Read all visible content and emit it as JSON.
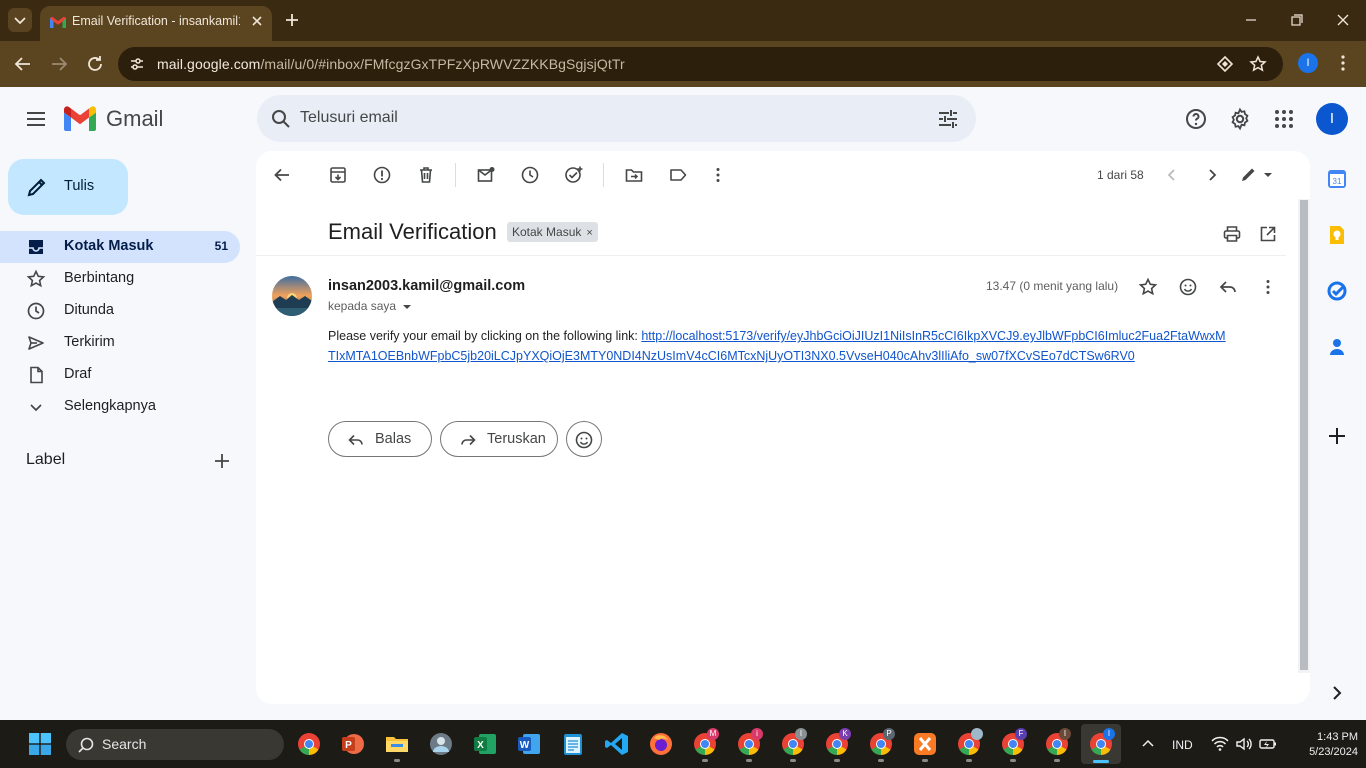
{
  "browser": {
    "tab_title": "Email Verification - insankamil1",
    "url_host": "mail.google.com",
    "url_path": "/mail/u/0/#inbox/FMfcgzGxTPFzXpRWVZZKKBgSgjsjQtTr",
    "profile_initial": "I"
  },
  "header": {
    "app_name": "Gmail",
    "search_placeholder": "Telusuri email",
    "avatar_initial": "I"
  },
  "sidebar": {
    "compose_label": "Tulis",
    "items": [
      {
        "label": "Kotak Masuk",
        "count": "51",
        "icon": "inbox-icon"
      },
      {
        "label": "Berbintang",
        "count": "",
        "icon": "star-icon"
      },
      {
        "label": "Ditunda",
        "count": "",
        "icon": "clock-icon"
      },
      {
        "label": "Terkirim",
        "count": "",
        "icon": "send-icon"
      },
      {
        "label": "Draf",
        "count": "",
        "icon": "draft-icon"
      },
      {
        "label": "Selengkapnya",
        "count": "",
        "icon": "chevron-down-icon"
      }
    ],
    "labels_heading": "Label"
  },
  "message_view": {
    "pager": "1 dari 58",
    "subject": "Email Verification",
    "label_chip": "Kotak Masuk",
    "sender": "insan2003.kamil@gmail.com",
    "recipient": "kepada saya",
    "time": "13.47 (0 menit yang lalu)",
    "body_prefix": "Please verify your email by clicking on the following link: ",
    "link": "http://localhost:5173/verify/eyJhbGciOiJIUzI1NiIsInR5cCI6IkpXVCJ9.eyJlbWFpbCI6Imluc2Fua2FtaWwxMTIxMTA1OEBnbWFpbC5jb20iLCJpYXQiOjE3MTY0NDI4NzUsImV4cCI6MTcxNjUyOTI3NX0.5VvseH040cAhv3lIliAfo_sw07fXCvSEo7dCTSw6RV0",
    "reply_button": "Balas",
    "forward_button": "Teruskan"
  },
  "taskbar": {
    "search_label": "Search",
    "language": "IND",
    "time": "1:43 PM",
    "date": "5/23/2024"
  },
  "colors": {
    "frame": "#5b4420",
    "gmail_bg": "#f6f8fc",
    "compose_bg": "#c2e7ff",
    "active_nav": "#d3e3fd",
    "link": "#1155cc"
  }
}
